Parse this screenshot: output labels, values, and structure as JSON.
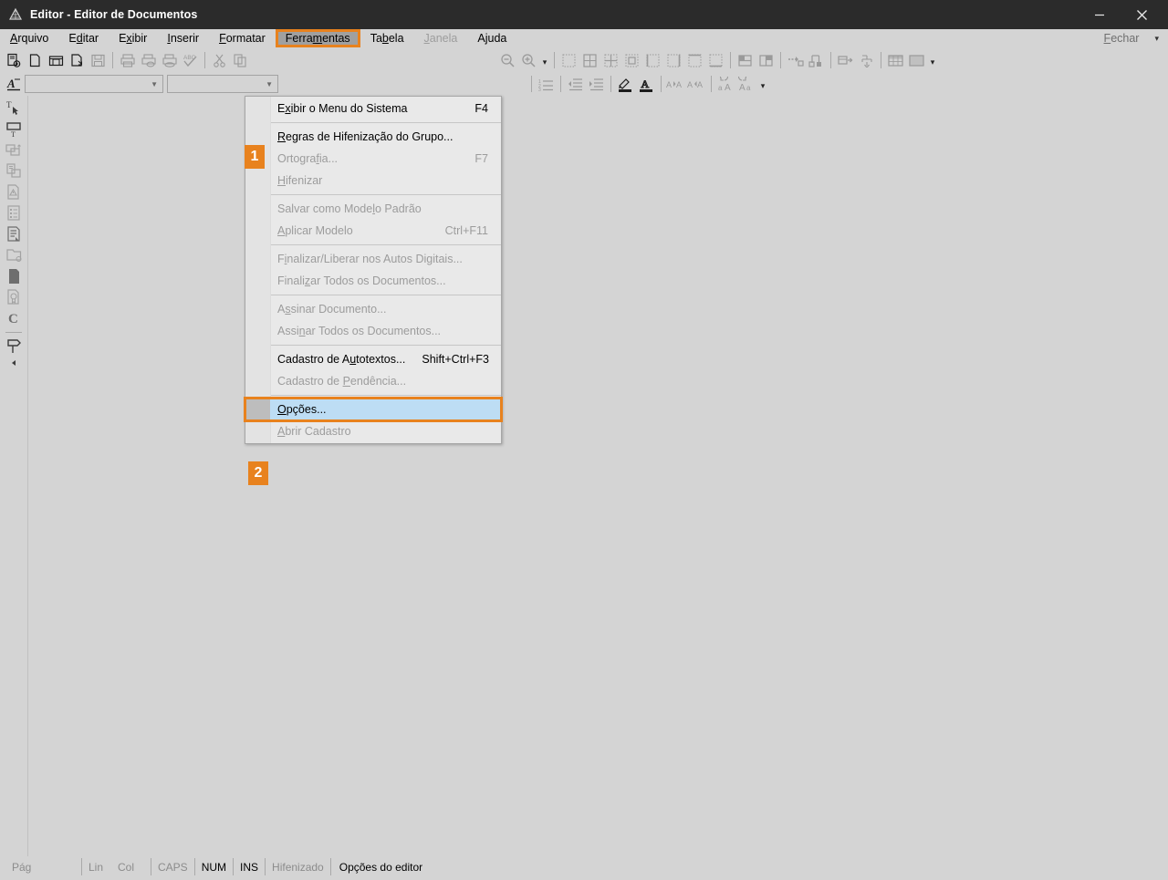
{
  "window": {
    "title": "Editor - Editor de Documentos",
    "icon": "app-pyramid-icon",
    "minimize_label": "Minimizar",
    "close_label": "Fechar"
  },
  "menubar": {
    "items": [
      {
        "label": "Arquivo",
        "accel_index": 0,
        "state": "normal"
      },
      {
        "label": "Editar",
        "accel_index": 1,
        "state": "normal"
      },
      {
        "label": "Exibir",
        "accel_index": 1,
        "state": "normal"
      },
      {
        "label": "Inserir",
        "accel_index": 0,
        "state": "normal"
      },
      {
        "label": "Formatar",
        "accel_index": 0,
        "state": "normal"
      },
      {
        "label": "Ferramentas",
        "accel_index": 5,
        "state": "active"
      },
      {
        "label": "Tabela",
        "accel_index": 2,
        "state": "normal"
      },
      {
        "label": "Janela",
        "accel_index": 0,
        "state": "disabled"
      },
      {
        "label": "Ajuda",
        "accel_index": 1,
        "state": "normal"
      }
    ],
    "right": {
      "label": "Fechar",
      "accel_index": 0,
      "caret": "▾"
    }
  },
  "toolbar": {
    "row1": [
      {
        "name": "new-document-with-template-icon",
        "glyph": "🗎",
        "state": "dark"
      },
      {
        "name": "new-document-icon",
        "glyph": "⬜",
        "state": "dark"
      },
      {
        "name": "open-document-icon",
        "glyph": "📁",
        "state": "dark"
      },
      {
        "name": "open-recent-icon",
        "glyph": "🗋",
        "state": "dark"
      },
      {
        "name": "save-icon",
        "glyph": "💾",
        "state": "dim"
      },
      {
        "name": "separator",
        "glyph": "",
        "state": "sep"
      },
      {
        "name": "print-icon",
        "glyph": "🖶",
        "state": "dim"
      },
      {
        "name": "print-preview-icon",
        "glyph": "🖶",
        "state": "dim"
      },
      {
        "name": "print-direct-icon",
        "glyph": "🖶",
        "state": "dim"
      },
      {
        "name": "spellcheck-icon",
        "glyph": "ABC",
        "state": "dim"
      },
      {
        "name": "separator",
        "glyph": "",
        "state": "sep"
      },
      {
        "name": "cut-icon",
        "glyph": "✂",
        "state": "dim"
      },
      {
        "name": "copy-icon",
        "glyph": "⧉",
        "state": "dim"
      }
    ],
    "row1b": [
      {
        "name": "zoom-out-icon",
        "state": "dim"
      },
      {
        "name": "zoom-in-icon",
        "state": "dim"
      },
      {
        "name": "zoom-dropdown-icon",
        "state": "caret"
      },
      {
        "name": "separator",
        "state": "sep"
      },
      {
        "name": "border-none-icon",
        "state": "dim"
      },
      {
        "name": "border-all-icon",
        "state": "dim"
      },
      {
        "name": "border-inner-icon",
        "state": "dim"
      },
      {
        "name": "border-box-icon",
        "state": "dim"
      },
      {
        "name": "border-left-icon",
        "state": "dim"
      },
      {
        "name": "border-right-icon",
        "state": "dim"
      },
      {
        "name": "border-top-icon",
        "state": "dim"
      },
      {
        "name": "border-bottom-icon",
        "state": "dim"
      },
      {
        "name": "separator",
        "state": "sep"
      },
      {
        "name": "merge-cells-icon",
        "state": "dim"
      },
      {
        "name": "split-cells-icon",
        "state": "dim"
      },
      {
        "name": "separator",
        "state": "sep"
      },
      {
        "name": "insert-row-icon",
        "state": "dim"
      },
      {
        "name": "insert-column-icon",
        "state": "dim"
      },
      {
        "name": "separator",
        "state": "sep"
      },
      {
        "name": "table-properties-icon",
        "state": "dim"
      },
      {
        "name": "table-sort-icon",
        "state": "dim"
      },
      {
        "name": "separator",
        "state": "sep"
      },
      {
        "name": "table-style-1-icon",
        "state": "dim"
      },
      {
        "name": "table-style-2-icon",
        "state": "dim"
      },
      {
        "name": "table-dropdown-icon",
        "state": "caret"
      }
    ],
    "row2_left": {
      "style_icon": "paragraph-style-icon",
      "font_name": {
        "value": "",
        "placeholder": ""
      },
      "font_size": {
        "value": "",
        "placeholder": ""
      }
    },
    "row2_right": [
      {
        "name": "ordered-list-icon",
        "state": "dim"
      },
      {
        "name": "separator",
        "state": "sep"
      },
      {
        "name": "decrease-indent-icon",
        "state": "dim"
      },
      {
        "name": "increase-indent-icon",
        "state": "dim"
      },
      {
        "name": "separator",
        "state": "sep"
      },
      {
        "name": "highlight-color-icon",
        "state": "dark"
      },
      {
        "name": "font-color-icon",
        "state": "dark"
      },
      {
        "name": "separator",
        "state": "sep"
      },
      {
        "name": "increase-spacing-icon",
        "state": "dim"
      },
      {
        "name": "decrease-spacing-icon",
        "state": "dim"
      },
      {
        "name": "separator",
        "state": "sep"
      },
      {
        "name": "increase-font-icon",
        "state": "dim"
      },
      {
        "name": "decrease-font-icon",
        "state": "dim"
      },
      {
        "name": "more-options-icon",
        "state": "caret"
      }
    ]
  },
  "sidebar": {
    "items": [
      {
        "name": "select-text-icon",
        "state": "dark"
      },
      {
        "name": "text-frame-icon",
        "state": "dark"
      },
      {
        "name": "insert-object-icon",
        "state": "dim"
      },
      {
        "name": "duplicate-page-icon",
        "state": "dim"
      },
      {
        "name": "warning-document-icon",
        "state": "dim"
      },
      {
        "name": "list-document-icon",
        "state": "dim"
      },
      {
        "name": "annotated-document-icon",
        "state": "mid"
      },
      {
        "name": "folder-document-icon",
        "state": "dim"
      },
      {
        "name": "page-icon",
        "state": "mid"
      },
      {
        "name": "certificate-icon",
        "state": "dim"
      },
      {
        "name": "letter-c-icon",
        "state": "mid"
      },
      {
        "name": "separator",
        "state": "sep"
      },
      {
        "name": "flag-marker-icon",
        "state": "dark"
      },
      {
        "name": "collapse-panel-icon",
        "state": "dark"
      }
    ]
  },
  "dropdown": {
    "owner": "Ferramentas",
    "items": [
      {
        "type": "item",
        "label": "Exibir o Menu do Sistema",
        "accel_index": 1,
        "shortcut": "F4",
        "state": "normal"
      },
      {
        "type": "separator"
      },
      {
        "type": "item",
        "label": "Regras de Hifenização do Grupo...",
        "accel_index": 0,
        "shortcut": "",
        "state": "normal"
      },
      {
        "type": "item",
        "label": "Ortografia...",
        "accel_index": 7,
        "shortcut": "F7",
        "state": "disabled"
      },
      {
        "type": "item",
        "label": "Hifenizar",
        "accel_index": 0,
        "shortcut": "",
        "state": "disabled"
      },
      {
        "type": "separator"
      },
      {
        "type": "item",
        "label": "Salvar como Modelo Padrão",
        "accel_index": 16,
        "shortcut": "",
        "state": "disabled"
      },
      {
        "type": "item",
        "label": "Aplicar Modelo",
        "accel_index": 0,
        "shortcut": "Ctrl+F11",
        "state": "disabled"
      },
      {
        "type": "separator"
      },
      {
        "type": "item",
        "label": "Finalizar/Liberar nos Autos Digitais...",
        "accel_index": 1,
        "shortcut": "",
        "state": "disabled"
      },
      {
        "type": "item",
        "label": "Finalizar Todos os Documentos...",
        "accel_index": 6,
        "shortcut": "",
        "state": "disabled"
      },
      {
        "type": "separator"
      },
      {
        "type": "item",
        "label": "Assinar Documento...",
        "accel_index": 1,
        "shortcut": "",
        "state": "disabled"
      },
      {
        "type": "item",
        "label": "Assinar Todos os Documentos...",
        "accel_index": 4,
        "shortcut": "",
        "state": "disabled"
      },
      {
        "type": "separator"
      },
      {
        "type": "item",
        "label": "Cadastro de Autotextos...",
        "accel_index": 13,
        "shortcut": "Shift+Ctrl+F3",
        "state": "normal"
      },
      {
        "type": "item",
        "label": "Cadastro de Pendência...",
        "accel_index": 12,
        "shortcut": "",
        "state": "disabled"
      },
      {
        "type": "separator"
      },
      {
        "type": "item",
        "label": "Opções...",
        "accel_index": 0,
        "shortcut": "",
        "state": "highlight"
      },
      {
        "type": "item",
        "label": "Abrir Cadastro",
        "accel_index": 0,
        "shortcut": "",
        "state": "disabled"
      }
    ]
  },
  "annotations": {
    "badges": [
      {
        "id": "1",
        "label": "1",
        "target": "Ferramentas"
      },
      {
        "id": "2",
        "label": "2",
        "target": "Opções..."
      }
    ],
    "accent_color": "#e8821e",
    "highlight_color": "#bdddf4"
  },
  "statusbar": {
    "page": "Pág",
    "line": "Lin",
    "column": "Col",
    "caps": "CAPS",
    "num": "NUM",
    "ins": "INS",
    "hyphenated": "Hifenizado",
    "message": "Opções do editor"
  }
}
